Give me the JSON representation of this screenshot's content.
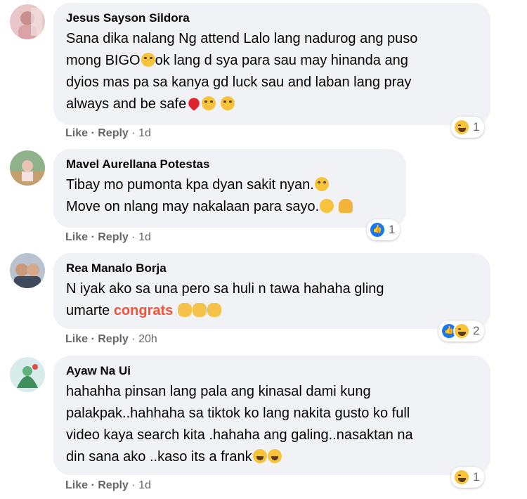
{
  "comments": [
    {
      "author": "Jesus Sayson Sildora",
      "line1": "Sana dika nalang Ng attend Lalo lang nadurog ang puso",
      "line2a": "mong BIGO",
      "line2b": "ok lang d sya para sau may hinanda ang",
      "line3": "dyios mas pa sa kanya gd luck sau and laban lang pray",
      "line4": "always and be safe",
      "like": "Like",
      "reply": "Reply",
      "time": "1d",
      "reaction_count": "1"
    },
    {
      "author": "Mavel Aurellana Potestas",
      "line1": "Tibay mo pumonta kpa dyan sakit nyan.",
      "line2": "Move on nlang may nakalaan para sayo.",
      "like": "Like",
      "reply": "Reply",
      "time": "1d",
      "reaction_count": "1"
    },
    {
      "author": "Rea Manalo Borja",
      "line1": "N iyak ako sa una pero sa huli n tawa hahaha gling",
      "line2a": "umarte",
      "highlight": "congrats",
      "like": "Like",
      "reply": "Reply",
      "time": "20h",
      "reaction_count": "2"
    },
    {
      "author": "Ayaw Na Ui",
      "line1": "hahahha pinsan lang pala ang kinasal dami kung",
      "line2": "palakpak..hahhaha sa tiktok ko lang nakita gusto ko full",
      "line3": "video kaya search kita .hahaha ang galing..nasaktan na",
      "line4": "din sana ako ..kaso its a frank",
      "like": "Like",
      "reply": "Reply",
      "time": "1d",
      "reaction_count": "1"
    }
  ],
  "colors": {
    "bubble": "#f0f2f5",
    "meta": "#65676b",
    "highlight": "#f3533b",
    "like_blue": "#1877f2"
  },
  "separator": "·"
}
